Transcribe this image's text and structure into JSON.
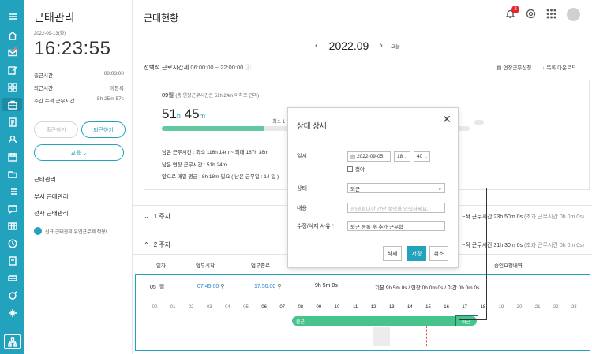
{
  "rail": {
    "icons": [
      "menu-icon",
      "home-icon",
      "mail-icon",
      "edit-icon",
      "grid-icon",
      "briefcase-icon",
      "document-icon",
      "person-icon",
      "calendar-icon",
      "folder-icon",
      "list-icon",
      "chat-icon",
      "table-icon",
      "clock-icon",
      "file-icon",
      "stack-icon",
      "badge-icon",
      "org-icon",
      "sitemap-icon"
    ]
  },
  "panel": {
    "title": "근태관리",
    "date": "2022-09-13(화)",
    "clock": "16:23:55",
    "rows": [
      {
        "label": "출근시간",
        "value": "08:03:00"
      },
      {
        "label": "퇴근시간",
        "value": "미등록"
      },
      {
        "label": "주간 누적 근무시간",
        "value": "5h 25m 57s"
      }
    ],
    "btn_in": "출근하기",
    "btn_out": "퇴근하기",
    "btn_edu": "교육",
    "menu": [
      "근태관리",
      "부서 근태관리",
      "전사 근태관리"
    ],
    "notice": "신규 근태관리 유연근무제 적용!"
  },
  "main": {
    "title": "근태현황",
    "notif_count": "2",
    "month": "2022.09",
    "today": "오늘",
    "sel_label": "선택적 근로시간제",
    "sel_time": "06:00:00 ~ 22:00:00",
    "tools": [
      "연장근무신청",
      "목록 다운로드"
    ],
    "summary": {
      "month": "09월",
      "month_note": "(총 연장근무시간은 51h 24m 이하로 관리)",
      "hours": "51",
      "h_unit": "h",
      "minutes": "45",
      "m_unit": "m",
      "min_label": "최소 1",
      "progress": 0.33,
      "lines": [
        "남은 근무시간 : 최소 116h 14m ~ 최대 167h 38m",
        "남은 연장 근무시간 : 51h 24m",
        "앞으로 매일 평균 : 8h 18m 필요 ( 남은 근무일 : 14 일 )"
      ]
    },
    "weeks": [
      {
        "label": "1 주차",
        "right": "~적 근무시간 23h 50m 0s",
        "extra": "(초과 근무시간 0h 0m 0s)"
      },
      {
        "label": "2 주차",
        "right": "~적 근무시간 31h 30m 0s",
        "extra": "(초과 근무시간 0h 0m 0s)"
      }
    ],
    "table_headers": [
      "일자",
      "업무시작",
      "업무종료",
      "승인요청내역"
    ],
    "day": {
      "date": "05",
      "weekday": "월",
      "start": "07:45:00",
      "end": "17:50:00",
      "total": "9h 5m 0s",
      "detail": "기본 9h 5m 0s / 연장 0h 0m 0s / 야간 0h 0m 0s",
      "hours": [
        "00",
        "01",
        "02",
        "03",
        "04",
        "05",
        "06",
        "07",
        "08",
        "09",
        "10",
        "11",
        "12",
        "13",
        "14",
        "15",
        "16",
        "17",
        "18",
        "19",
        "20",
        "21",
        "22",
        "23"
      ],
      "bar_start": "출근",
      "bar_end": "퇴근"
    }
  },
  "modal": {
    "title": "상태 상세",
    "date_label": "일시",
    "date_value": "2022-09-05",
    "hour": "18",
    "minute": "40",
    "overnight": "철야",
    "status_label": "상태",
    "status_value": "퇴근",
    "content_label": "내용",
    "content_placeholder": "상태에 대한 간단 설명을 입력하세요.",
    "reason_label": "수정/삭제 사유",
    "reason_value": "퇴근 등록 후 추가 근무함",
    "btn_delete": "삭제",
    "btn_save": "저장",
    "btn_cancel": "취소"
  }
}
